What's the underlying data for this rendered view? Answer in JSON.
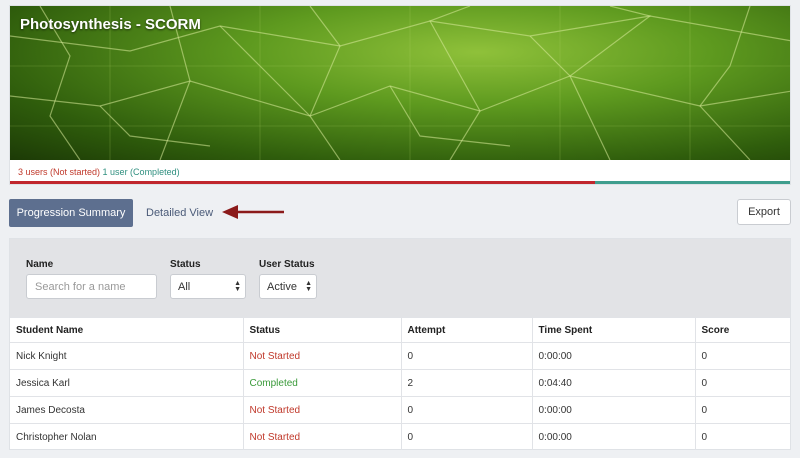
{
  "course": {
    "title": "Photosynthesis - SCORM",
    "status_not_started": "3 users (Not started)",
    "status_completed": "1 user (Completed)",
    "not_started_fraction": 0.75,
    "completed_fraction": 0.25
  },
  "colors": {
    "accent": "#5d6f8f",
    "not_started": "#c0392b",
    "completed": "#3a9a3a",
    "progress_red": "#c0262d",
    "progress_teal": "#3f9e8e"
  },
  "tabs": {
    "progression_summary": "Progression Summary",
    "detailed_view": "Detailed View"
  },
  "actions": {
    "export": "Export"
  },
  "filters": {
    "name_label": "Name",
    "name_placeholder": "Search for a name",
    "status_label": "Status",
    "status_value": "All",
    "user_status_label": "User Status",
    "user_status_value": "Active"
  },
  "table": {
    "headers": [
      "Student Name",
      "Status",
      "Attempt",
      "Time Spent",
      "Score"
    ],
    "rows": [
      [
        "Nick Knight",
        "Not Started",
        "0",
        "0:00:00",
        "0"
      ],
      [
        "Jessica Karl",
        "Completed",
        "2",
        "0:04:40",
        "0"
      ],
      [
        "James Decosta",
        "Not Started",
        "0",
        "0:00:00",
        "0"
      ],
      [
        "Christopher Nolan",
        "Not Started",
        "0",
        "0:00:00",
        "0"
      ]
    ]
  },
  "icons": {
    "arrow": "arrow-left-icon",
    "caret": "up-down-caret-icon"
  }
}
